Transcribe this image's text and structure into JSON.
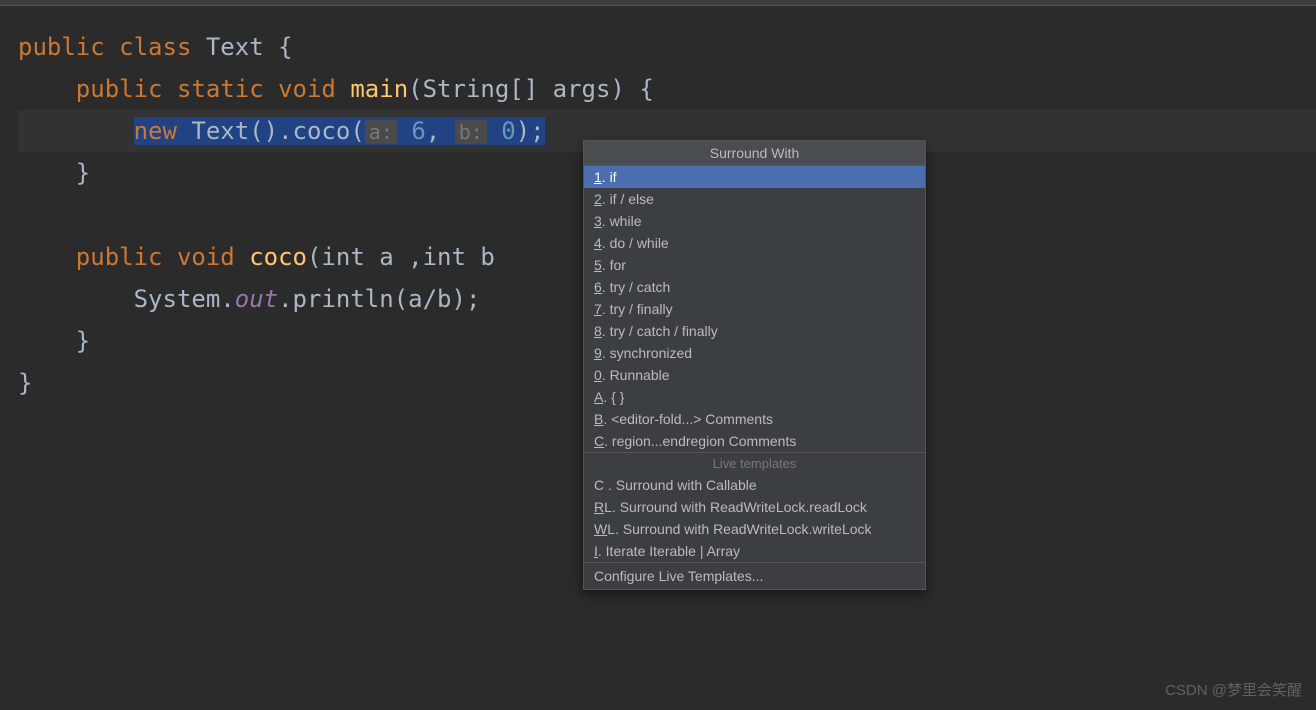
{
  "code": {
    "line1": {
      "pre": "public class ",
      "name": "Text",
      "post": " {"
    },
    "line2": {
      "indent": "    ",
      "mod": "public static void ",
      "fn": "main",
      "params": "(String[] args) {"
    },
    "line3": {
      "indent": "        ",
      "kw": "new ",
      "call": "Text().coco(",
      "hint1": "a:",
      "arg1": " 6",
      "comma": ", ",
      "hint2": "b:",
      "arg2": " 0",
      "end": ");"
    },
    "line4": "    }",
    "line5": "",
    "line6": {
      "indent": "    ",
      "mod": "public void ",
      "fn": "coco",
      "params": "(int a ,int b"
    },
    "line7": {
      "indent": "        ",
      "cls": "System.",
      "field": "out",
      "call": ".println(a/b);"
    },
    "line8": "    }",
    "line9": "}"
  },
  "popup": {
    "title": "Surround With",
    "items": [
      {
        "key": "1",
        "label": ". if"
      },
      {
        "key": "2",
        "label": ". if / else"
      },
      {
        "key": "3",
        "label": ". while"
      },
      {
        "key": "4",
        "label": ". do / while"
      },
      {
        "key": "5",
        "label": ". for"
      },
      {
        "key": "6",
        "label": ". try / catch"
      },
      {
        "key": "7",
        "label": ". try / finally"
      },
      {
        "key": "8",
        "label": ". try / catch / finally"
      },
      {
        "key": "9",
        "label": ". synchronized"
      },
      {
        "key": "0",
        "label": ". Runnable"
      },
      {
        "key": "A",
        "label": ". { }"
      },
      {
        "key": "B",
        "label": ". <editor-fold...> Comments"
      },
      {
        "key": "C",
        "label": ". region...endregion Comments"
      }
    ],
    "separator": "Live templates",
    "live": [
      {
        "key": "C ",
        "label": ". Surround with Callable"
      },
      {
        "key": "R",
        "rest": "L",
        "label": ". Surround with ReadWriteLock.readLock"
      },
      {
        "key": "W",
        "rest": "L",
        "label": ". Surround with ReadWriteLock.writeLock"
      },
      {
        "key": "I",
        "label": ". Iterate Iterable | Array"
      }
    ],
    "footer": "Configure Live Templates..."
  },
  "watermark": "CSDN @梦里会笑醒"
}
